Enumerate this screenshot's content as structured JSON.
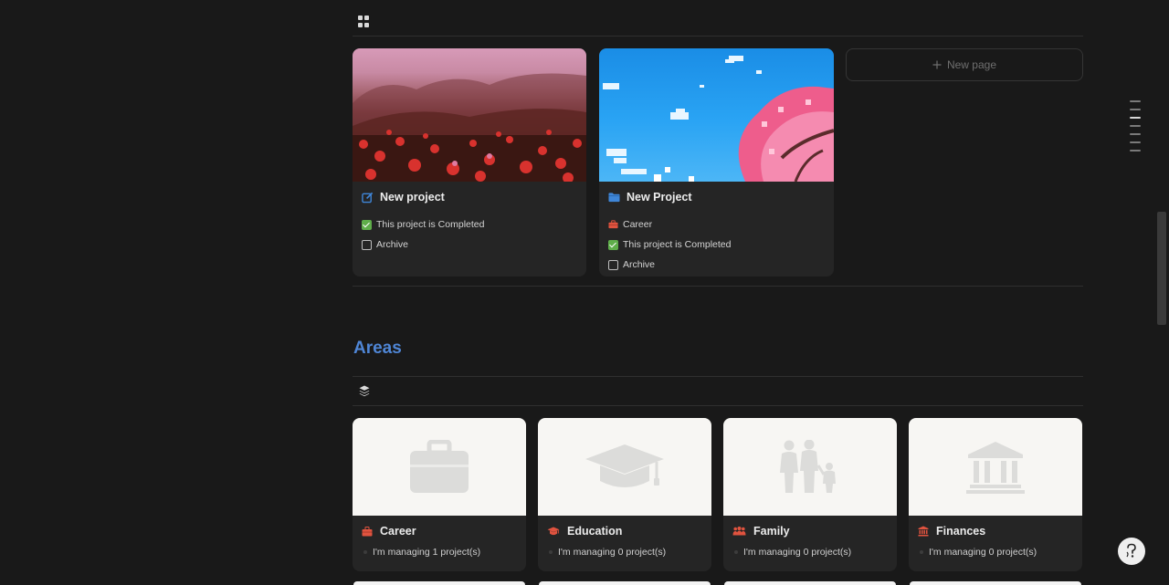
{
  "gallery": {
    "view_icon": "gallery-grid-icon",
    "new_page_label": "New page",
    "cards": [
      {
        "title": "New project",
        "icon": "edit-icon",
        "cover": "red-flower-field",
        "properties": [
          {
            "type": "checkbox",
            "checked": true,
            "label": "This project is Completed"
          },
          {
            "type": "checkbox",
            "checked": false,
            "label": "Archive"
          }
        ]
      },
      {
        "title": "New Project",
        "icon": "folder-icon",
        "cover": "pixel-cherry-blossom-sky",
        "area": "Career",
        "properties": [
          {
            "type": "checkbox",
            "checked": true,
            "label": "This project is Completed"
          },
          {
            "type": "checkbox",
            "checked": false,
            "label": "Archive"
          }
        ]
      }
    ]
  },
  "areas": {
    "heading": "Areas",
    "view_icon": "layers-icon",
    "cards": [
      {
        "title": "Career",
        "icon": "briefcase-icon",
        "cover_icon": "briefcase-icon",
        "summary": "I'm managing 1 project(s)"
      },
      {
        "title": "Education",
        "icon": "graduation-cap-icon",
        "cover_icon": "graduation-cap-icon",
        "summary": "I'm managing 0 project(s)"
      },
      {
        "title": "Family",
        "icon": "people-icon",
        "cover_icon": "family-icon",
        "summary": "I'm managing 0 project(s)"
      },
      {
        "title": "Finances",
        "icon": "bank-icon",
        "cover_icon": "bank-icon",
        "summary": "I'm managing 0 project(s)"
      }
    ]
  },
  "colors": {
    "background": "#191919",
    "card": "#252525",
    "accent_heading": "#4f86d6",
    "icon_red": "#e0533f",
    "icon_blue": "#3f86d8",
    "checkbox_green": "#5fae4a"
  }
}
